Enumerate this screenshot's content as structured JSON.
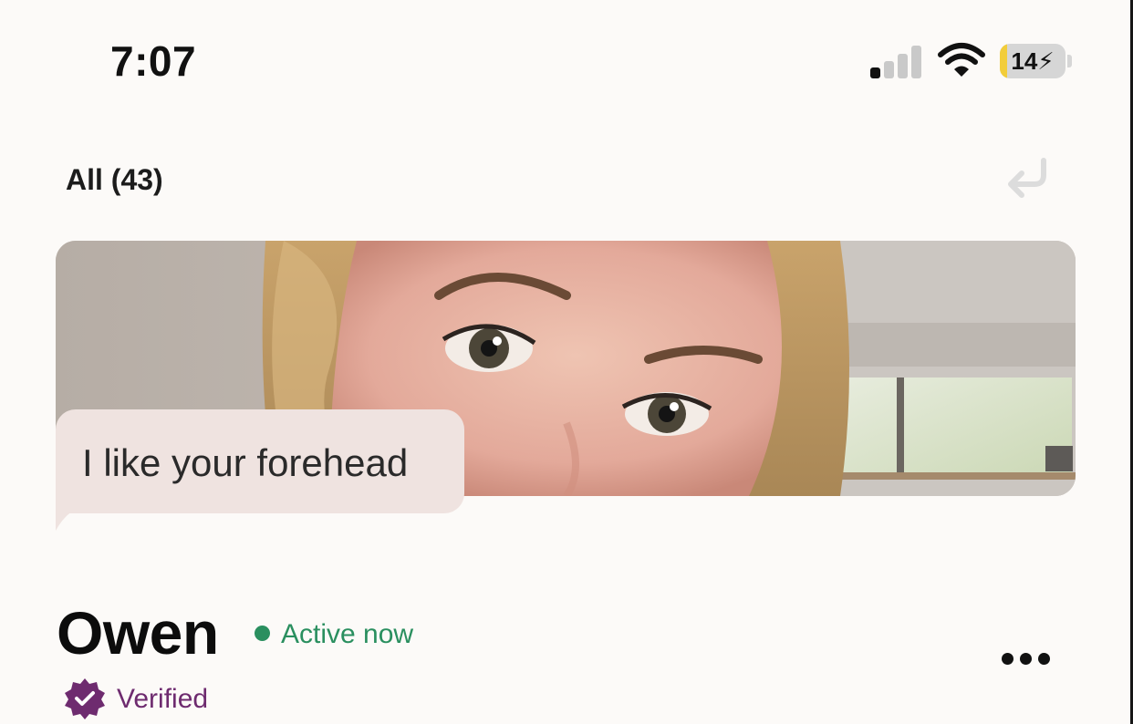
{
  "status_bar": {
    "time": "7:07",
    "battery_level": "14",
    "signal_bars_active": 1,
    "signal_bars_total": 4
  },
  "header": {
    "filter_label": "All (43)",
    "undo_icon": "undo-arrow-icon"
  },
  "card": {
    "comment": "I like your forehead"
  },
  "profile": {
    "name": "Owen",
    "status": "Active now",
    "verified_label": "Verified",
    "more_icon": "more-dots-icon"
  },
  "colors": {
    "background": "#fcfaf8",
    "active_green": "#2a8f5f",
    "verified_purple": "#6e2b6f",
    "bubble": "#efe3e0",
    "battery_charge": "#f2cd3a"
  }
}
